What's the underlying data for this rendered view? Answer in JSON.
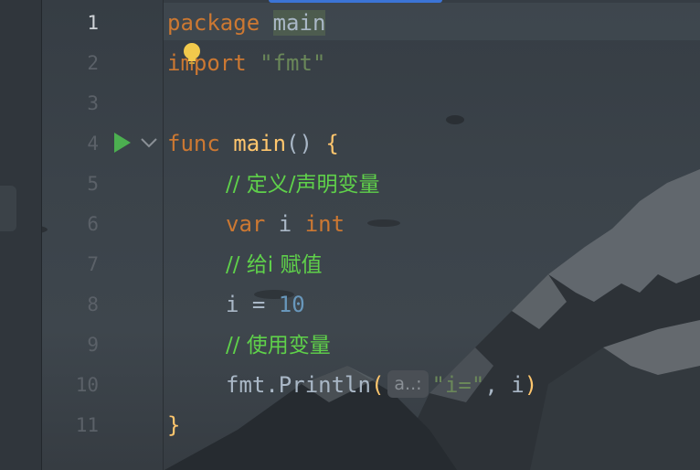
{
  "editor": {
    "lines": [
      {
        "number": "1",
        "parts": [
          [
            "kw",
            "package "
          ],
          [
            "pkg",
            "main"
          ]
        ]
      },
      {
        "number": "2",
        "parts": [
          [
            "kw",
            "import "
          ],
          [
            "str",
            "\"fmt\""
          ]
        ]
      },
      {
        "number": "3",
        "parts": []
      },
      {
        "number": "4",
        "parts": [
          [
            "kw",
            "func "
          ],
          [
            "fn",
            "main"
          ],
          [
            "id",
            "() "
          ],
          [
            "fn",
            "{"
          ]
        ]
      },
      {
        "number": "5",
        "parts": [
          [
            "cm",
            "// 定义/声明变量"
          ]
        ]
      },
      {
        "number": "6",
        "parts": [
          [
            "kw",
            "var "
          ],
          [
            "id",
            "i "
          ],
          [
            "kw",
            "int"
          ]
        ]
      },
      {
        "number": "7",
        "parts": [
          [
            "cm",
            "// 给i 赋值"
          ]
        ]
      },
      {
        "number": "8",
        "parts": [
          [
            "id",
            "i = "
          ],
          [
            "num",
            "10"
          ]
        ]
      },
      {
        "number": "9",
        "parts": [
          [
            "cm",
            "// 使用变量"
          ]
        ]
      },
      {
        "number": "10",
        "parts": [
          [
            "id",
            "fmt."
          ],
          [
            "id",
            "Println"
          ],
          [
            "fn",
            "("
          ],
          [
            "hint",
            "a..:"
          ],
          [
            "str",
            "\"i=\""
          ],
          [
            "id",
            ", i"
          ],
          [
            "fn",
            ")"
          ]
        ]
      },
      {
        "number": "11",
        "parts": [
          [
            "fn",
            "}"
          ]
        ]
      }
    ],
    "active_line": "1",
    "colors": {
      "keyword": "#cc7832",
      "function": "#ffc66d",
      "string": "#6a8759",
      "number": "#6897bb",
      "comment": "#5fd14a"
    }
  },
  "gutter": {
    "run_icon": "run-triangle-icon",
    "fold_icon": "chevron-down-icon",
    "intention_icon": "lightbulb-icon"
  }
}
